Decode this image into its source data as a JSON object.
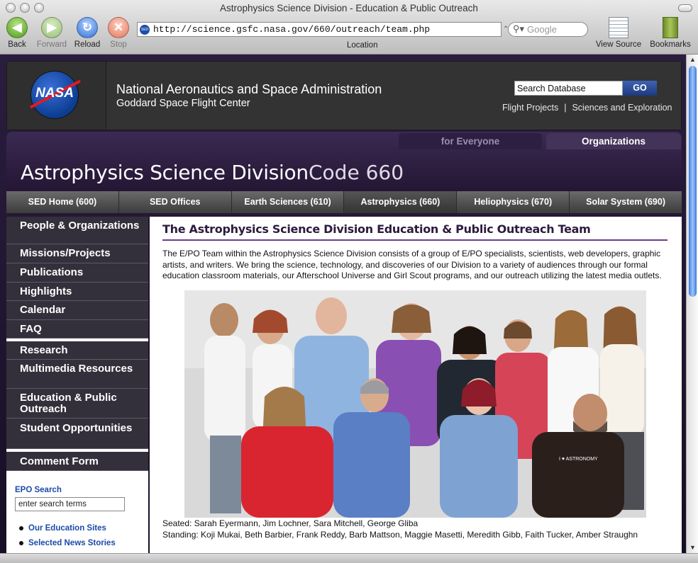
{
  "window": {
    "title": "Astrophysics Science Division - Education & Public Outreach"
  },
  "toolbar": {
    "back": "Back",
    "forward": "Forward",
    "reload": "Reload",
    "stop": "Stop",
    "url": "http://science.gsfc.nasa.gov/660/outreach/team.php",
    "favicon": "SED",
    "search_placeholder": "Google",
    "location_label": "Location",
    "view_source": "View Source",
    "bookmarks": "Bookmarks"
  },
  "header": {
    "logo_text": "NASA",
    "org_line1": "National Aeronautics and Space Administration",
    "org_line2": "Goddard Space Flight Center",
    "search_value": "Search Database",
    "go_label": "GO",
    "link1": "Flight Projects",
    "sep": "|",
    "link2": "Sciences and Exploration"
  },
  "banner": {
    "tab_everyone": "for Everyone",
    "tab_orgs": "Organizations",
    "title": "Astrophysics Science Division",
    "code": "Code 660"
  },
  "nav": [
    {
      "label": "SED Home (600)"
    },
    {
      "label": "SED Offices"
    },
    {
      "label": "Earth Sciences (610)"
    },
    {
      "label": "Astrophysics (660)"
    },
    {
      "label": "Heliophysics (670)"
    },
    {
      "label": "Solar System (690)"
    }
  ],
  "sidebar": {
    "items": [
      {
        "label": "People & Organizations"
      },
      {
        "label": "Missions/Projects"
      },
      {
        "label": "Publications"
      },
      {
        "label": "Highlights"
      },
      {
        "label": "Calendar"
      },
      {
        "label": "FAQ"
      },
      {
        "label": "Research"
      },
      {
        "label": "Multimedia Resources"
      },
      {
        "label": "Education & Public Outreach"
      },
      {
        "label": "Student Opportunities"
      },
      {
        "label": "Comment Form"
      }
    ],
    "epo_search_label": "EPO Search",
    "epo_search_value": "enter search terms",
    "link1": "Our Education Sites",
    "link2": "Selected News Stories"
  },
  "main": {
    "heading": "The Astrophysics Science Division Education & Public Outreach Team",
    "paragraph": "The E/PO Team within the Astrophysics Science Division consists of a group of E/PO specialists, scientists, web developers, graphic artists, and writers. We bring the science, technology, and discoveries of our Division to a variety of audiences through our formal education classroom materials, our Afterschool Universe and Girl Scout programs, and our outreach utilizing the latest media outlets.",
    "shirt_text": "I ♥ ASTRONOMY",
    "caption_seated": "Seated: Sarah Eyermann, Jim Lochner, Sara Mitchell, George Gliba",
    "caption_standing": "Standing: Koji Mukai, Beth Barbier, Frank Reddy, Barb Mattson, Maggie Masetti, Meredith Gibb, Faith Tucker, Amber Straughn"
  }
}
